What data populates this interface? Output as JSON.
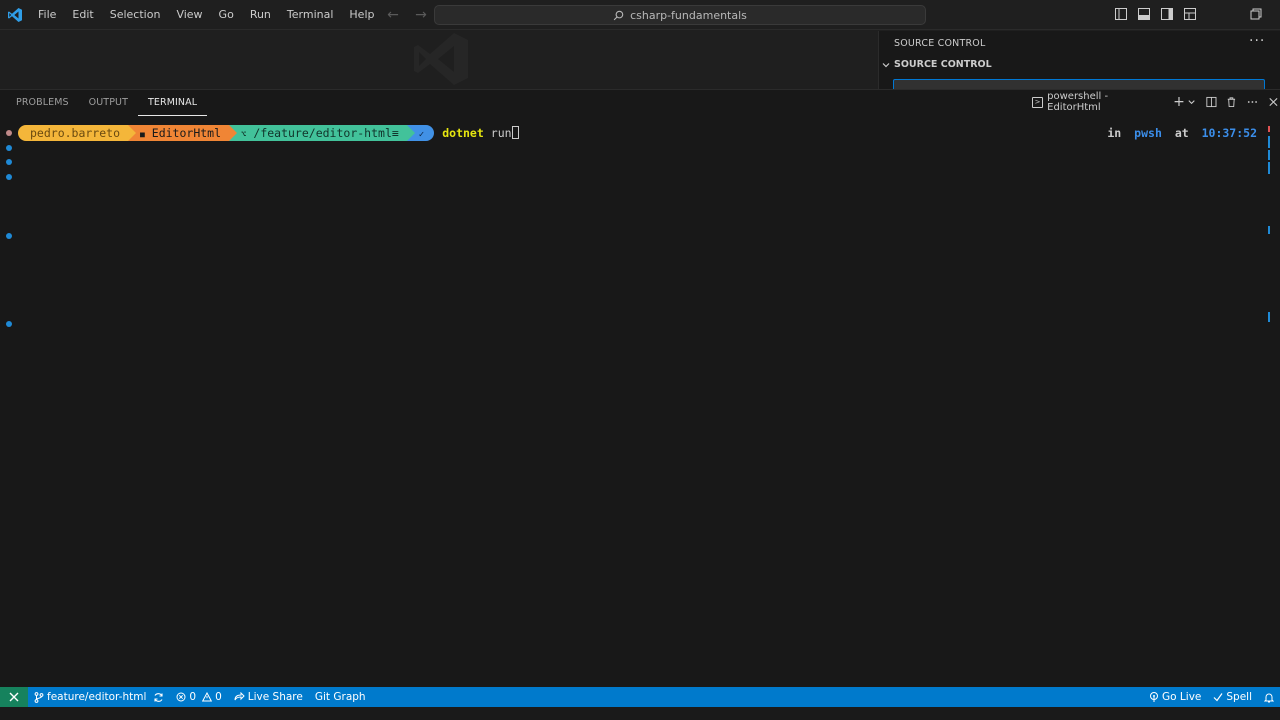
{
  "menu": [
    "File",
    "Edit",
    "Selection",
    "View",
    "Go",
    "Run",
    "Terminal",
    "Help"
  ],
  "command_center": {
    "text": "csharp-fundamentals"
  },
  "sidebar": {
    "title": "SOURCE CONTROL",
    "section": "SOURCE CONTROL",
    "more": "···"
  },
  "panel": {
    "tabs": [
      "PROBLEMS",
      "OUTPUT",
      "TERMINAL"
    ],
    "active_tab": "TERMINAL",
    "terminal_name": "powershell - EditorHtml"
  },
  "terminal": {
    "prompt": {
      "user": "pedro.barreto",
      "folder": "EditorHtml",
      "folder_icon": "■",
      "branch_icon": "⌥",
      "branch": "/feature/editor-html≡",
      "status": "✓"
    },
    "command": "dotnet",
    "args": "run",
    "right_prompt": {
      "in": "in",
      "shell": "pwsh",
      "at": "at",
      "time": "10:37:52"
    }
  },
  "statusbar": {
    "branch": "feature/editor-html",
    "errors": "0",
    "warnings": "0",
    "live_share": "Live Share",
    "git_graph": "Git Graph",
    "go_live": "Go Live",
    "spell": "Spell"
  },
  "colors": {
    "accent": "#007acc",
    "user_segment": "#f4b63a",
    "path_segment": "#f08535",
    "git_segment": "#42c29a",
    "status_segment": "#4191e6"
  }
}
